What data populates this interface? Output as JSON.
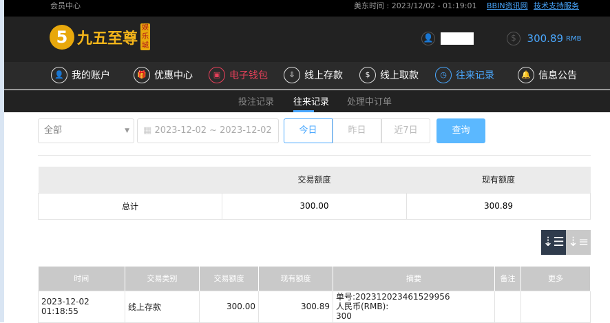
{
  "topbar": {
    "member_center": "会员中心",
    "time": "美东时间 : 2023/12/02 - 01:19:01",
    "link1": "BBIN资讯网",
    "link2": "技术支持服务"
  },
  "header": {
    "logo_text": "九五至尊",
    "logo_badge": "娱乐城",
    "logo_mark": "5",
    "balance": "300.89",
    "currency": "RMB"
  },
  "nav": [
    {
      "label": "我的账户"
    },
    {
      "label": "优惠中心"
    },
    {
      "label": "电子钱包"
    },
    {
      "label": "线上存款"
    },
    {
      "label": "线上取款"
    },
    {
      "label": "往来记录"
    },
    {
      "label": "信息公告"
    }
  ],
  "subnav": [
    "投注记录",
    "往来记录",
    "处理中订单"
  ],
  "filter": {
    "type": "全部",
    "date_range": "2023-12-02 ~ 2023-12-02",
    "today": "今日",
    "yesterday": "昨日",
    "last7": "近7日",
    "query": "查询"
  },
  "summary": {
    "headers": [
      "",
      "交易额度",
      "现有额度"
    ],
    "row": [
      "总计",
      "300.00",
      "300.89"
    ]
  },
  "detail": {
    "headers": [
      "时间",
      "交易类别",
      "交易额度",
      "现有额度",
      "摘要",
      "备注",
      "更多"
    ],
    "rows": [
      {
        "time": "2023-12-02 01:18:55",
        "type": "线上存款",
        "amount": "300.00",
        "balance": "300.89",
        "summary1": "单号:202312023461529956",
        "summary2": "人民币(RMB):",
        "summary3": "300",
        "note": "",
        "more": ""
      }
    ]
  },
  "colors": {
    "accent": "#4aa8ff",
    "active_red": "#e8405a"
  }
}
